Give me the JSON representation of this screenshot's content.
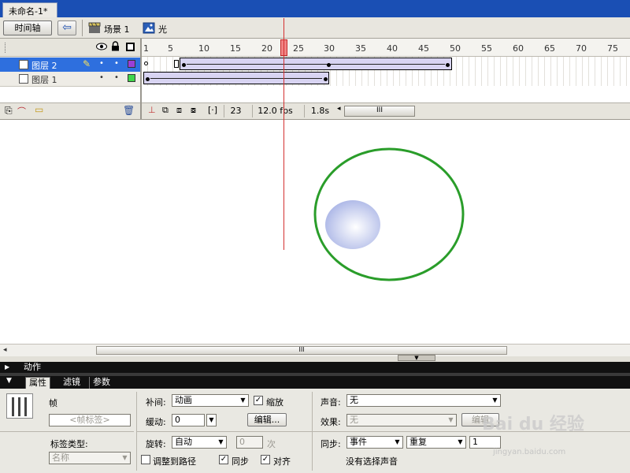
{
  "document_tab": {
    "title": "未命名-1*"
  },
  "edit_bar": {
    "timeline_button": "时间轴",
    "scene_label": "场景 1",
    "symbol_label": "光"
  },
  "timeline": {
    "ruler_ticks": [
      "1",
      "5",
      "10",
      "15",
      "20",
      "25",
      "30",
      "35",
      "40",
      "45",
      "50",
      "55",
      "60",
      "65",
      "70",
      "75"
    ],
    "layers": [
      {
        "name": "图层 2",
        "selected": true,
        "color": "#9b3fd6"
      },
      {
        "name": "图层 1",
        "selected": false,
        "color": "#3fd64a"
      }
    ],
    "current_frame": "23",
    "fps": "12.0 fps",
    "elapsed": "1.8s",
    "scroll_thumb": "III",
    "playhead_frame": 23
  },
  "stage": {
    "scroll_thumb": "III",
    "ring_color": "#2a9d2a",
    "ball_color": "#aab5e6"
  },
  "panels": {
    "actions_label": "动作",
    "tabs": [
      "属性",
      "滤镜",
      "参数"
    ],
    "frame_label": "帧",
    "frame_label_placeholder": "<帧标签>",
    "label_type_caption": "标签类型:",
    "label_type_value": "名称",
    "tween_caption": "补间:",
    "tween_value": "动画",
    "scale_label": "缩放",
    "ease_caption": "缓动:",
    "ease_value": "0",
    "edit_button": "编辑...",
    "rotate_caption": "旋转:",
    "rotate_value": "自动",
    "rotate_count": "0",
    "rotate_unit": "次",
    "orient_to_path": "调整到路径",
    "sync_label": "同步",
    "snap_label": "对齐",
    "sound_caption": "声音:",
    "sound_value": "无",
    "effect_caption": "效果:",
    "effect_value": "无",
    "effect_edit_button": "编辑",
    "sync_caption": "同步:",
    "sync_event": "事件",
    "repeat_value": "重复",
    "repeat_count": "1",
    "no_sound_note": "没有选择声音"
  },
  "watermark": {
    "brand": "Bai du 经验",
    "url": "jingyan.baidu.com"
  }
}
